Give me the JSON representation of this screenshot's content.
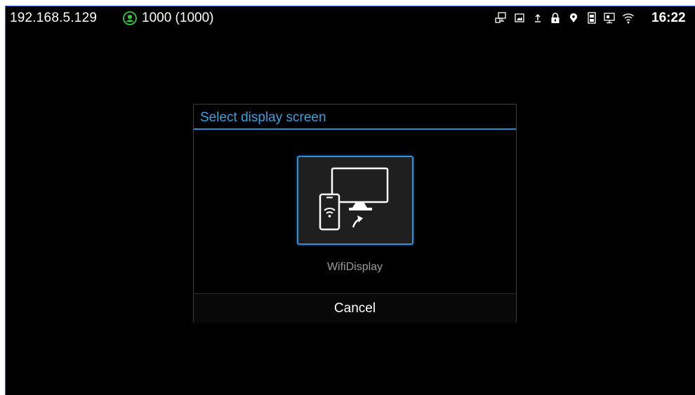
{
  "status_bar": {
    "ip_address": "192.168.5.129",
    "account": "1000 (1000)",
    "account_status_color": "#2ecc40",
    "icons": [
      "network-icon",
      "image-icon",
      "upload-icon",
      "lock-icon",
      "location-icon",
      "sim-card-icon",
      "monitor-icon",
      "wifi-icon"
    ],
    "time": "16:22"
  },
  "dialog": {
    "title": "Select display screen",
    "items": [
      {
        "label": "WifiDisplay",
        "icon": "wifi-display-icon",
        "selected": true
      }
    ],
    "cancel_label": "Cancel"
  },
  "colors": {
    "accent": "#33a3e8",
    "background": "#000000",
    "tile_border": "#2f8fe0",
    "tile_bg": "#1f1f1f"
  }
}
